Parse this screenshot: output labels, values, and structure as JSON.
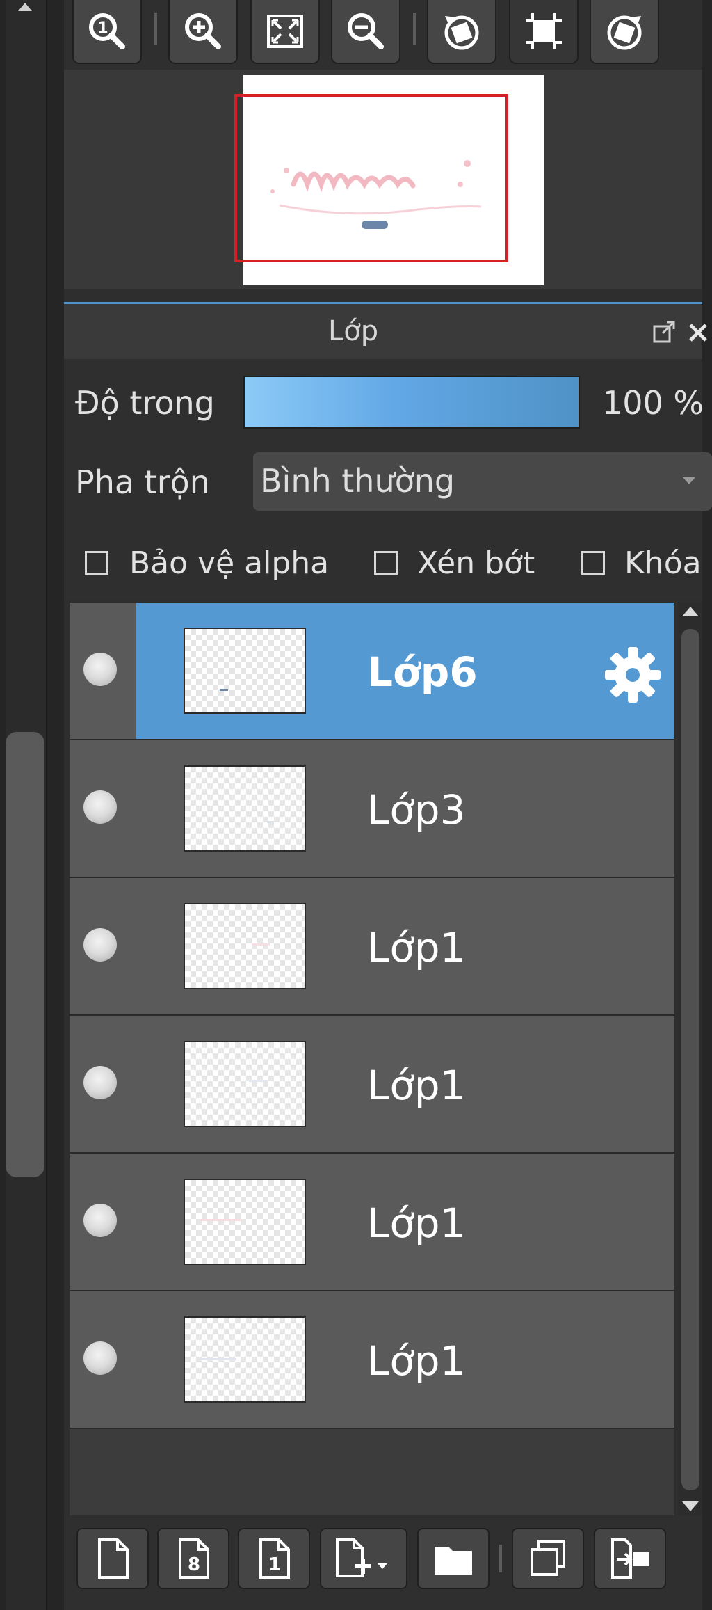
{
  "navigator": {
    "toolbar": [
      {
        "name": "zoom-actual-size-button",
        "icon": "zoom-1-icon"
      },
      {
        "name": "zoom-in-button",
        "icon": "zoom-in-icon"
      },
      {
        "name": "fit-to-window-button",
        "icon": "fit-window-icon"
      },
      {
        "name": "zoom-out-button",
        "icon": "zoom-out-icon"
      },
      {
        "name": "rotate-left-button",
        "icon": "rotate-left-icon"
      },
      {
        "name": "fit-canvas-button",
        "icon": "fit-canvas-icon"
      },
      {
        "name": "rotate-right-button",
        "icon": "rotate-right-icon"
      }
    ]
  },
  "layer_panel": {
    "title": "Lớp",
    "opacity_label": "Độ trong",
    "opacity_value": "100 %",
    "opacity_fraction": 1.0,
    "blend_label": "Pha trộn",
    "blend_value": "Bình thường",
    "checkbox_protect_alpha": "Bảo vệ alpha",
    "checkbox_clipping": "Xén bớt",
    "checkbox_lock": "Khóa",
    "layers": [
      {
        "name": "Lớp6",
        "selected": true
      },
      {
        "name": "Lớp3",
        "selected": false
      },
      {
        "name": "Lớp1",
        "selected": false
      },
      {
        "name": "Lớp1",
        "selected": false
      },
      {
        "name": "Lớp1",
        "selected": false
      },
      {
        "name": "Lớp1",
        "selected": false
      }
    ]
  },
  "bottom_toolbar": [
    {
      "name": "new-layer-button",
      "icon": "new-page-icon"
    },
    {
      "name": "new-8bit-layer-button",
      "icon": "page-8-icon"
    },
    {
      "name": "new-1bit-layer-button",
      "icon": "page-1-icon"
    },
    {
      "name": "add-layer-menu-button",
      "icon": "page-add-dropdown-icon"
    },
    {
      "name": "new-folder-button",
      "icon": "folder-icon"
    },
    {
      "name": "duplicate-layer-button",
      "icon": "duplicate-icon"
    },
    {
      "name": "merge-down-button",
      "icon": "merge-down-icon"
    }
  ],
  "colors": {
    "selected_row": "#5499d2",
    "navigator_frame": "#d81f26",
    "panel_accent": "#4f94cc"
  }
}
